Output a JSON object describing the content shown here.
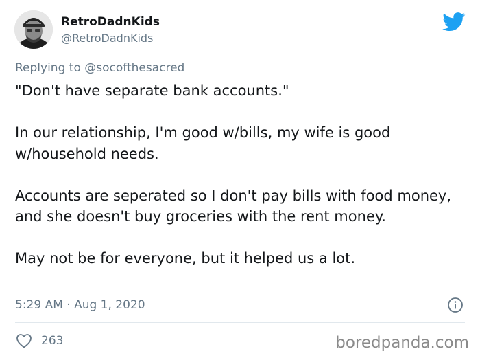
{
  "header": {
    "display_name": "RetroDadnKids",
    "handle": "@RetroDadnKids"
  },
  "icons": {
    "twitter_logo": "twitter-bird-icon",
    "info": "info-icon",
    "like": "heart-icon"
  },
  "colors": {
    "brand": "#1da1f2",
    "secondary_text": "#657786",
    "primary_text": "#14171a"
  },
  "reply": {
    "prefix": "Replying to",
    "mention": "@socofthesacred"
  },
  "tweet": {
    "paragraphs": [
      "\"Don't have separate bank accounts.\"",
      "In our relationship, I'm good w/bills, my wife is good w/household needs.",
      "Accounts are seperated so I don't pay bills with food money, and she doesn't buy groceries with the rent money.",
      "May not be for everyone, but it helped us a lot."
    ]
  },
  "meta": {
    "timestamp": "5:29 AM · Aug 1, 2020"
  },
  "actions": {
    "likes": "263"
  },
  "watermark": "boredpanda.com"
}
